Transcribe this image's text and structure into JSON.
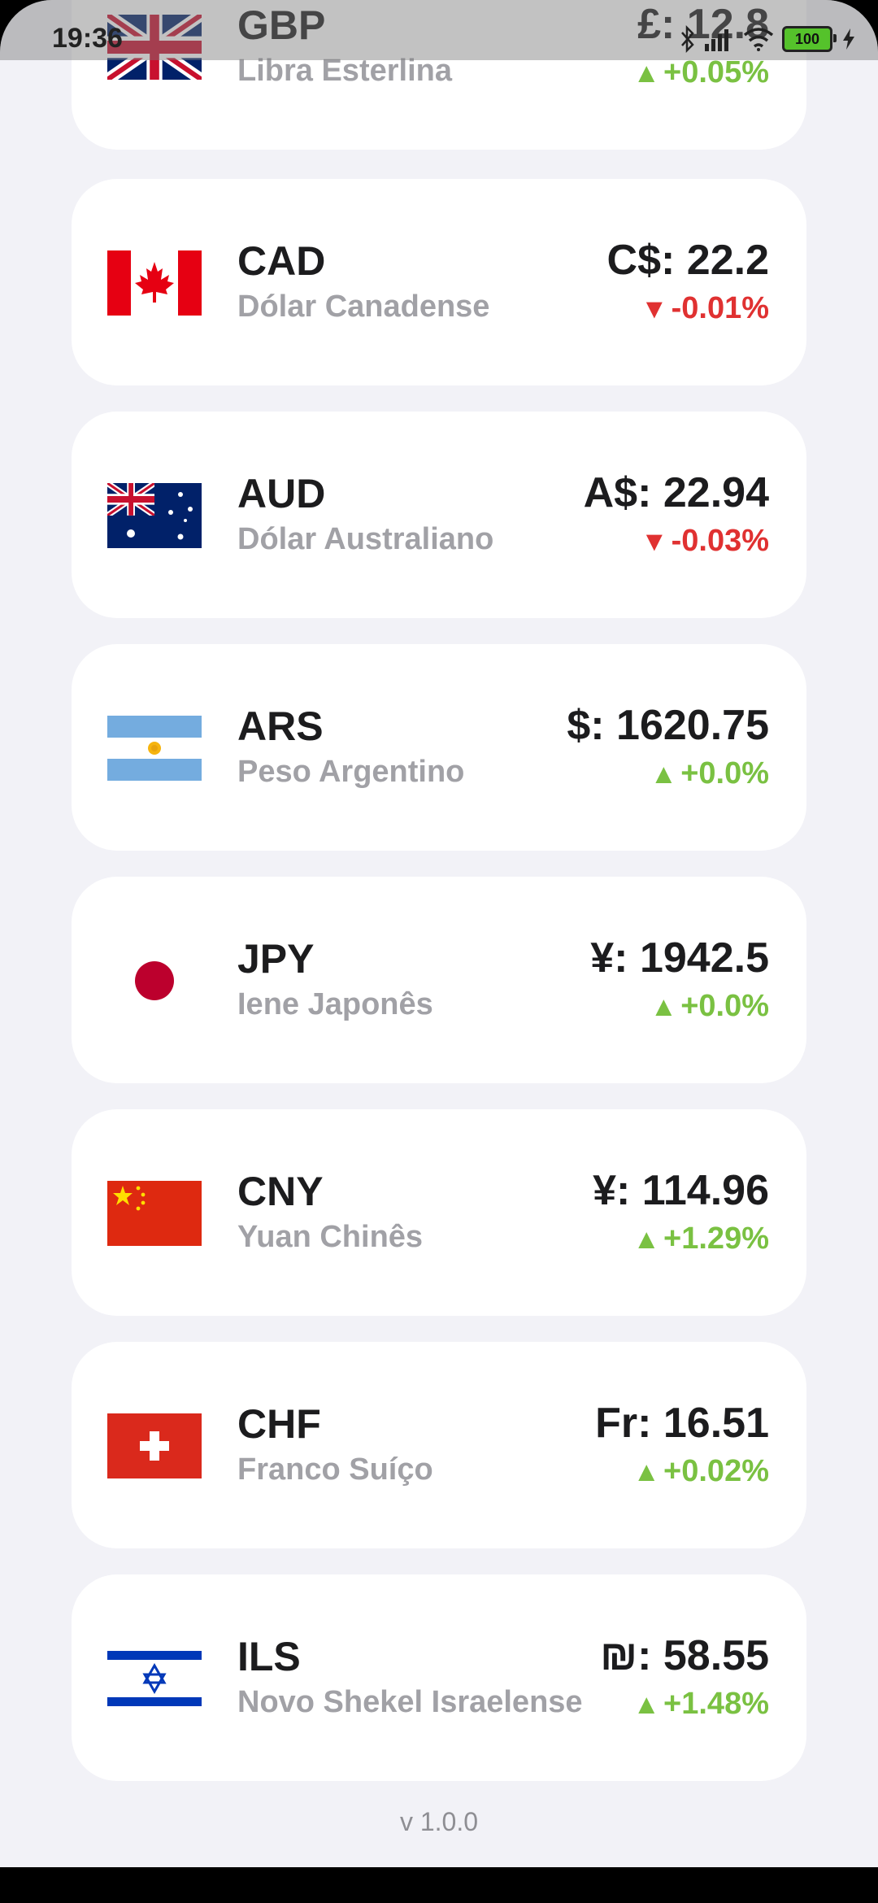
{
  "status_bar": {
    "time": "19:36",
    "battery": "100"
  },
  "colors": {
    "up": "#7ac142",
    "down": "#e03131"
  },
  "currencies": [
    {
      "code": "GBP",
      "name": "Libra Esterlina",
      "rate": "£: 12.8",
      "change": "+0.05%",
      "direction": "up",
      "flag": "uk-flag-icon"
    },
    {
      "code": "CAD",
      "name": "Dólar Canadense",
      "rate": "C$: 22.2",
      "change": "-0.01%",
      "direction": "down",
      "flag": "canada-flag-icon"
    },
    {
      "code": "AUD",
      "name": "Dólar Australiano",
      "rate": "A$: 22.94",
      "change": "-0.03%",
      "direction": "down",
      "flag": "australia-flag-icon"
    },
    {
      "code": "ARS",
      "name": "Peso Argentino",
      "rate": "$: 1620.75",
      "change": "+0.0%",
      "direction": "up",
      "flag": "argentina-flag-icon"
    },
    {
      "code": "JPY",
      "name": "Iene Japonês",
      "rate": "¥: 1942.5",
      "change": "+0.0%",
      "direction": "up",
      "flag": "japan-flag-icon"
    },
    {
      "code": "CNY",
      "name": "Yuan Chinês",
      "rate": "¥: 114.96",
      "change": "+1.29%",
      "direction": "up",
      "flag": "china-flag-icon"
    },
    {
      "code": "CHF",
      "name": "Franco Suíço",
      "rate": "Fr: 16.51",
      "change": "+0.02%",
      "direction": "up",
      "flag": "switzerland-flag-icon"
    },
    {
      "code": "ILS",
      "name": "Novo Shekel Israelense",
      "rate": "₪: 58.55",
      "change": "+1.48%",
      "direction": "up",
      "flag": "israel-flag-icon"
    }
  ],
  "footer": {
    "version": "v 1.0.0"
  }
}
